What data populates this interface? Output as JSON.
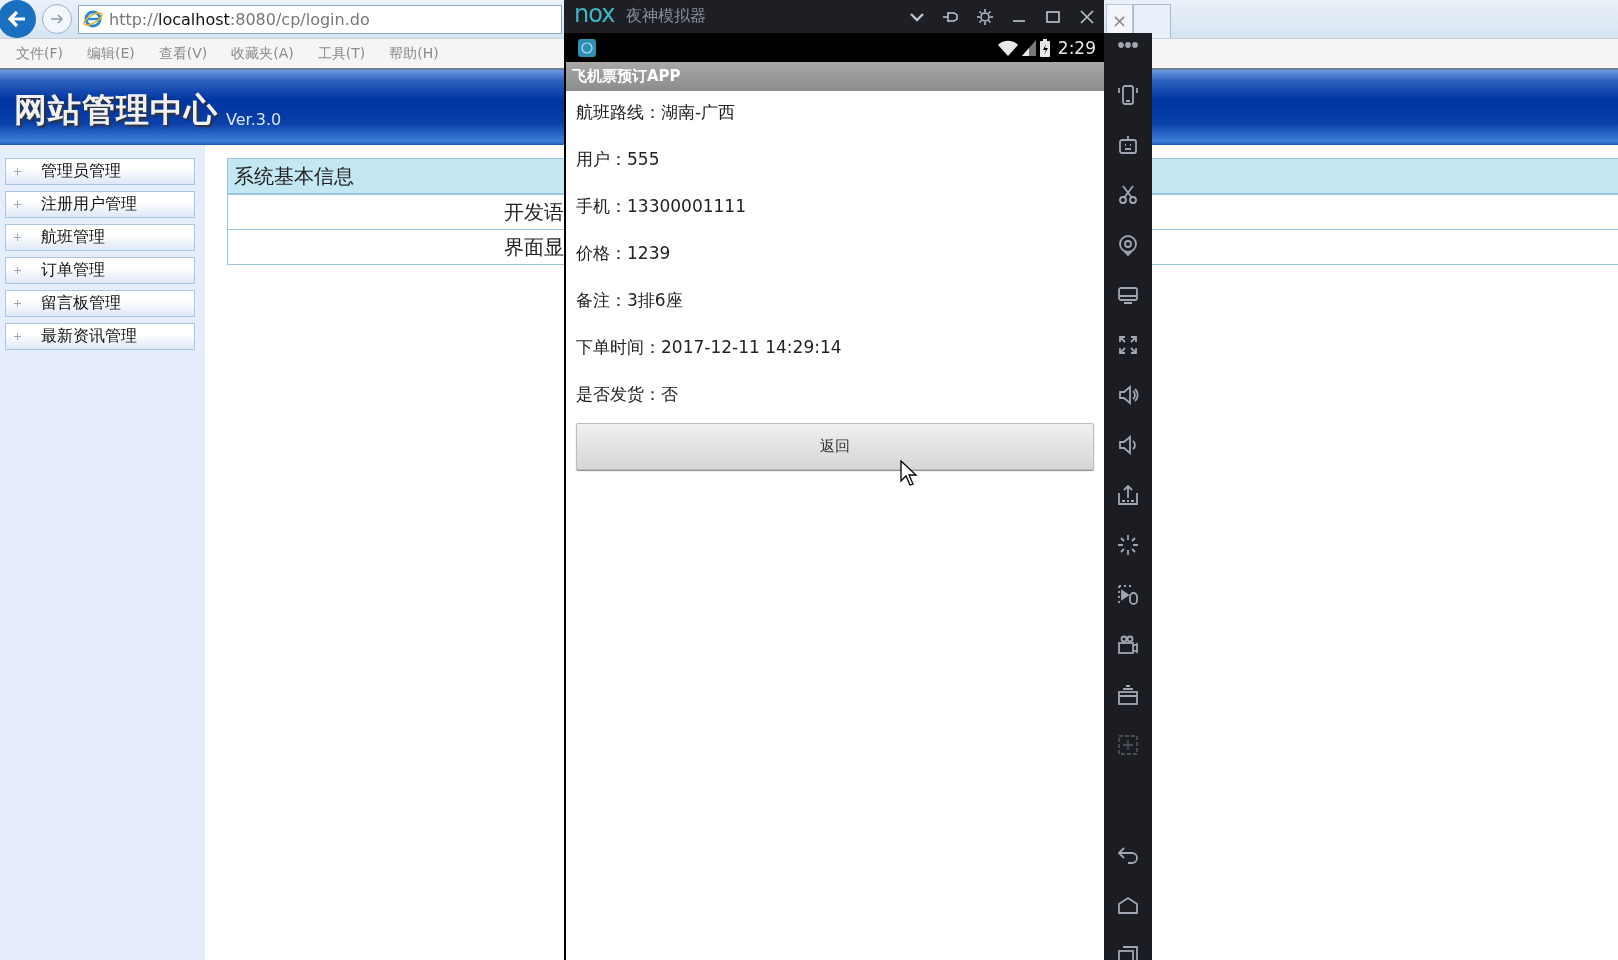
{
  "browser": {
    "address": "http://**localhost**:8080/cp/login.do",
    "menu": [
      "文件(F)",
      "编辑(E)",
      "查看(V)",
      "收藏夹(A)",
      "工具(T)",
      "帮助(H)"
    ],
    "tab_close": "×"
  },
  "site": {
    "title": "网站管理中心",
    "version": "Ver.3.0"
  },
  "sidebar": {
    "items": [
      "管理员管理",
      "注册用户管理",
      "航班管理",
      "订单管理",
      "留言板管理",
      "最新资讯管理"
    ]
  },
  "info_table": {
    "title": "系统基本信息",
    "rows": [
      "开发语",
      "界面显"
    ]
  },
  "emulator": {
    "logo": "nox",
    "title": "夜神模拟器",
    "status_time": "2:29",
    "app_title": "飞机票预订APP",
    "fields": [
      "航班路线：湖南-广西",
      "用户：555",
      "手机：13300001111",
      "价格：1239",
      "备注：3排6座",
      "下单时间：2017-12-11 14:29:14",
      "是否发货：否"
    ],
    "button": "返回",
    "toolbar": [
      {
        "kind": "more",
        "disabled": false
      },
      {
        "kind": "shake",
        "disabled": false
      },
      {
        "kind": "robot",
        "disabled": false
      },
      {
        "kind": "scissors",
        "disabled": false
      },
      {
        "kind": "location",
        "disabled": false
      },
      {
        "kind": "screen",
        "disabled": false
      },
      {
        "kind": "fullscreen",
        "disabled": false
      },
      {
        "kind": "volume-up",
        "disabled": false
      },
      {
        "kind": "volume-down",
        "disabled": false
      },
      {
        "kind": "apk",
        "disabled": false
      },
      {
        "kind": "loading",
        "disabled": false
      },
      {
        "kind": "macro",
        "disabled": false
      },
      {
        "kind": "camera",
        "disabled": false
      },
      {
        "kind": "windows",
        "disabled": false
      },
      {
        "kind": "add",
        "disabled": true
      },
      {
        "kind": "back",
        "disabled": false
      },
      {
        "kind": "home",
        "disabled": false
      },
      {
        "kind": "recent",
        "disabled": false
      }
    ]
  }
}
